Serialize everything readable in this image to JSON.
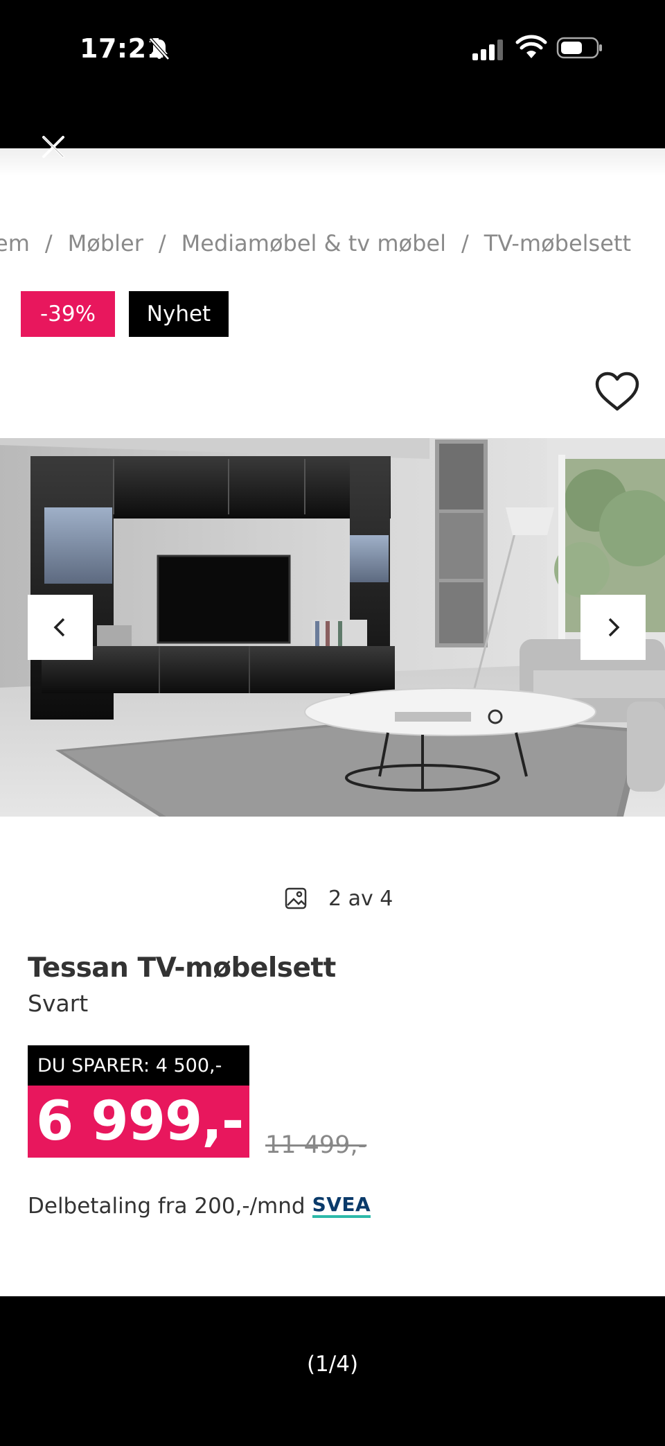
{
  "status_bar": {
    "time": "17:21",
    "icons": [
      "bell-slash-icon",
      "signal-icon",
      "wifi-icon",
      "battery-icon"
    ]
  },
  "viewer": {
    "close_icon": "close-icon",
    "page_indicator": "(1/4)"
  },
  "breadcrumb": [
    "em",
    "Møbler",
    "Mediamøbel & tv møbel",
    "TV-møbelsett"
  ],
  "badges": {
    "discount": "-39%",
    "new": "Nyhet"
  },
  "gallery": {
    "favorite_icon": "heart-icon",
    "prev_icon": "chevron-left-icon",
    "next_icon": "chevron-right-icon",
    "counter_icon": "image-icon",
    "counter": "2 av 4"
  },
  "product": {
    "title": "Tessan TV-møbelsett",
    "color": "Svart",
    "saving": "DU SPARER: 4 500,-",
    "price": "6 999,-",
    "old_price": "11 499,-",
    "installment": "Delbetaling fra 200,-/mnd",
    "installment_provider": "SVEA"
  },
  "colors": {
    "accent": "#e8175d",
    "badge_dark": "#000000",
    "provider_underline": "#2db9a9"
  }
}
